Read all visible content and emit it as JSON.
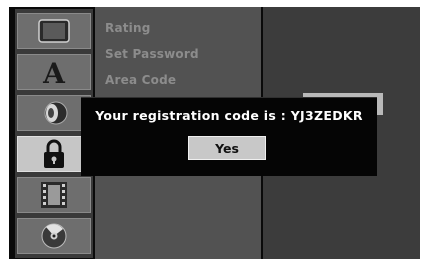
{
  "sidebar": {
    "icons": [
      {
        "name": "display-icon",
        "selected": false
      },
      {
        "name": "language-icon",
        "glyph": "A",
        "selected": false
      },
      {
        "name": "audio-icon",
        "selected": false
      },
      {
        "name": "lock-icon",
        "selected": true
      },
      {
        "name": "film-icon",
        "selected": false
      },
      {
        "name": "disc-icon",
        "selected": false
      }
    ]
  },
  "menu": {
    "items": [
      {
        "label": "Rating"
      },
      {
        "label": "Set Password"
      },
      {
        "label": "Area Code"
      }
    ]
  },
  "dialog": {
    "message": "Your registration code is : YJ3ZEDKR",
    "yes_label": "Yes"
  },
  "colors": {
    "background": "#0a0a0a",
    "menu_panel": "#525252",
    "selected_icon": "#c6c6c6",
    "dialog_bg": "#050505",
    "dialog_text": "#ffffff",
    "button_bg": "#c8c8c8"
  }
}
